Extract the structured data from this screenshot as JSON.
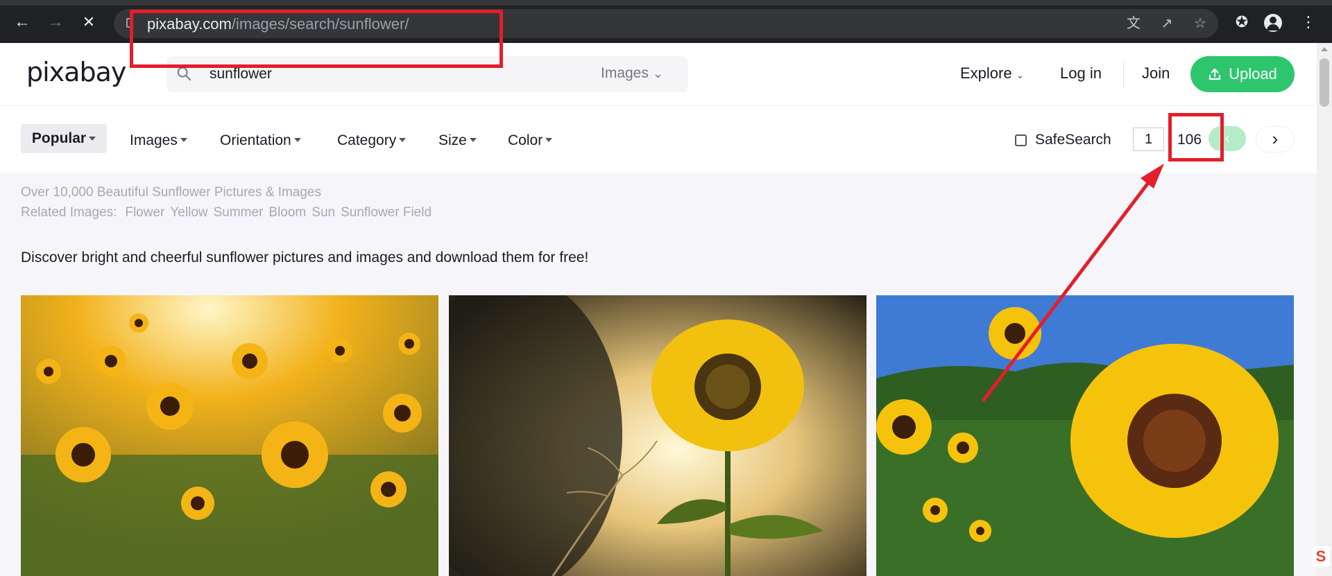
{
  "browser": {
    "url_domain": "pixabay.com",
    "url_path": "/images/search/sunflower/"
  },
  "header": {
    "logo": "pixabay",
    "search_value": "sunflower",
    "search_type": "Images",
    "explore": "Explore",
    "login": "Log in",
    "join": "Join",
    "upload": "Upload",
    "brand_color": "#2ec66d"
  },
  "filters": {
    "popular": "Popular",
    "items": [
      "Images",
      "Orientation",
      "Category",
      "Size",
      "Color"
    ],
    "safesearch": "SafeSearch",
    "page_current": "1",
    "page_total": "106"
  },
  "content": {
    "subtitle": "Over 10,000 Beautiful Sunflower Pictures & Images",
    "related_label": "Related Images:",
    "related": [
      "Flower",
      "Yellow",
      "Summer",
      "Bloom",
      "Sun",
      "Sunflower Field"
    ],
    "description": "Discover bright and cheerful sunflower pictures and images and download them for free!"
  },
  "annotation_color": "#e41e2a"
}
